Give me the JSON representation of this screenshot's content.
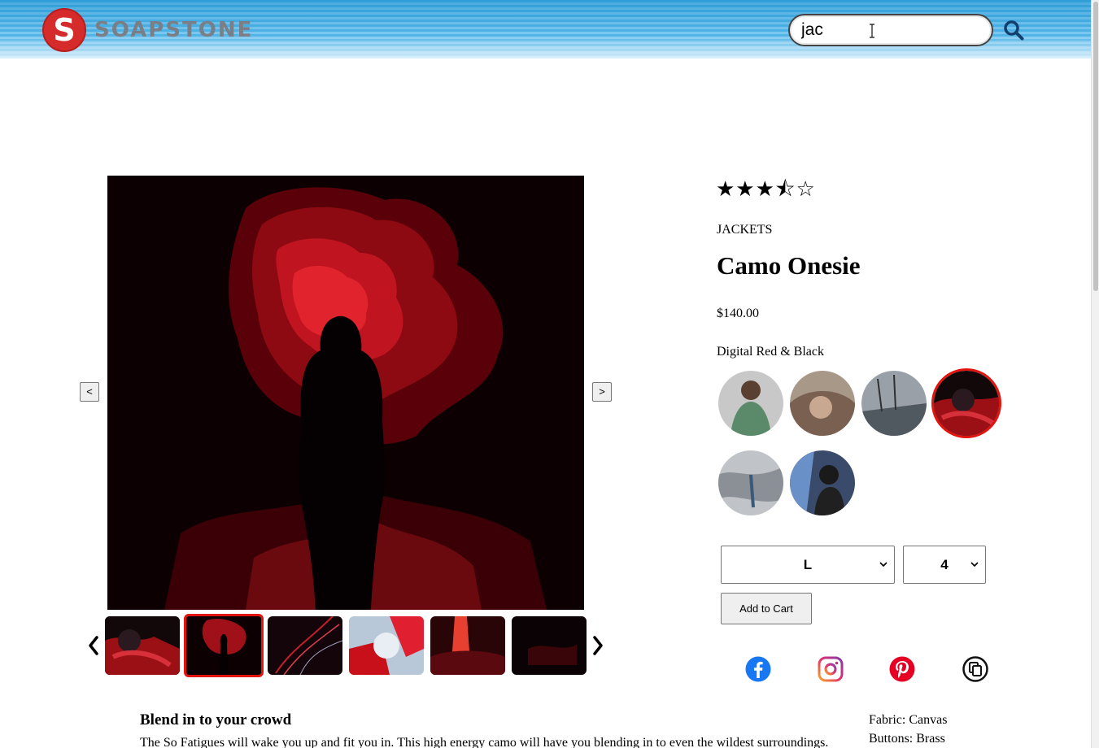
{
  "header": {
    "logo_letter": "S",
    "logo_text": "SOAPSTONE",
    "search_value": "jac"
  },
  "gallery": {
    "prev_label": "<",
    "next_label": ">",
    "selected_thumbnail_index": 1,
    "thumbnail_count": 6
  },
  "product": {
    "rating_stars": "★★★⯪☆",
    "rating_value": 3.5,
    "rating_max": 5,
    "category": "JACKETS",
    "name": "Camo Onesie",
    "price": "$140.00",
    "style_name": "Digital Red & Black",
    "selected_style_index": 3,
    "style_count": 6
  },
  "cart": {
    "size_value": "L",
    "quantity_value": "4",
    "add_label": "Add to Cart"
  },
  "share": {
    "icons": [
      "facebook-icon",
      "instagram-icon",
      "pinterest-icon",
      "copy-link-icon"
    ]
  },
  "description": {
    "heading": "Blend in to your crowd",
    "body": "The So Fatigues will wake you up and fit you in. This high energy camo will have you blending in to even the wildest surroundings."
  },
  "features": [
    {
      "text": "Fabric: Canvas"
    },
    {
      "text": "Buttons: Brass"
    }
  ],
  "colors": {
    "accent_red": "#e3140e",
    "header_blue": "#3aa9e0",
    "logo_red": "#d62b2b"
  }
}
